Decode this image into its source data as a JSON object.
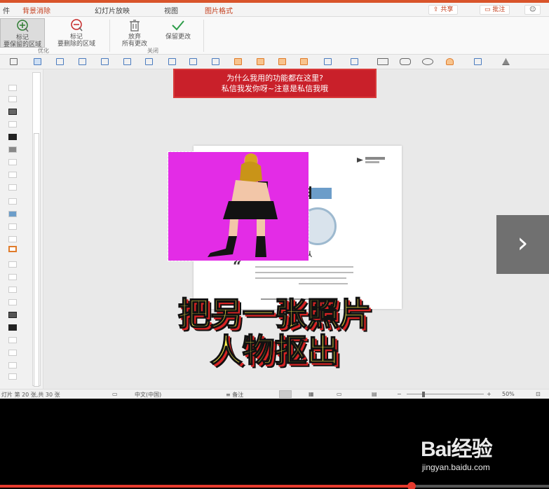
{
  "tabs": [
    {
      "label": "件",
      "active": false
    },
    {
      "label": "背景消除",
      "active": true
    },
    {
      "label": "幻灯片放映",
      "active": false
    },
    {
      "label": "视图",
      "active": false
    },
    {
      "label": "图片格式",
      "active": false
    }
  ],
  "title_actions": {
    "share": "共享",
    "comment": "批注"
  },
  "ribbon": {
    "mark_keep": "标记\n要保留的区域",
    "mark_remove": "标记\n要删除的区域",
    "discard": "放弃\n所有更改",
    "keep_changes": "保留更改",
    "group_optimize": "优化",
    "group_close": "关闭"
  },
  "banner": {
    "line1": "为什么我用的功能都在这里?",
    "line2": "私信我发你呀~注意是私信我哦"
  },
  "slide": {
    "quote_mark": "“",
    "fragment": "队"
  },
  "caption": {
    "line1": "把另一张照片",
    "line2": "人物抠出"
  },
  "next_label": "›",
  "status": {
    "slide_info": "灯片 第 20 张,共 30 张",
    "language": "中文(中国)",
    "notes": "备注",
    "zoom": "50%"
  },
  "watermark": {
    "brand": "Bai经验",
    "url": "jingyan.baidu.com"
  },
  "video": {
    "progress": 0.75
  },
  "colors": {
    "accent": "#d9542b",
    "banner_red": "#c9202a",
    "picture_bg": "#e32ce6",
    "caption_yellow": "#fff34a"
  }
}
